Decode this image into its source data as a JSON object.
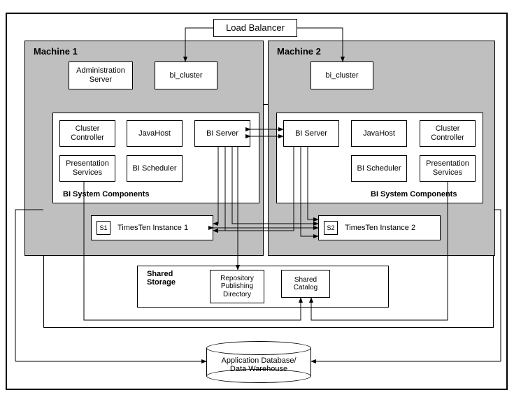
{
  "loadBalancer": "Load Balancer",
  "machine1": {
    "title": "Machine 1",
    "adminServer": "Administration\nServer",
    "biCluster": "bi_cluster",
    "sysTitle": "BI System Components",
    "clusterController": "Cluster\nController",
    "javaHost": "JavaHost",
    "biServer": "BI Server",
    "presentation": "Presentation\nServices",
    "biScheduler": "BI Scheduler",
    "s1": "S1",
    "tt1": "TimesTen Instance 1"
  },
  "machine2": {
    "title": "Machine 2",
    "biCluster": "bi_cluster",
    "sysTitle": "BI System Components",
    "clusterController": "Cluster\nController",
    "javaHost": "JavaHost",
    "biServer": "BI Server",
    "presentation": "Presentation\nServices",
    "biScheduler": "BI Scheduler",
    "s2": "S2",
    "tt2": "TimesTen Instance 2"
  },
  "sharedStorage": {
    "title": "Shared\nStorage",
    "repo": "Repository\nPublishing\nDirectory",
    "catalog": "Shared\nCatalog"
  },
  "db": "Application Database/\nData Warehouse"
}
